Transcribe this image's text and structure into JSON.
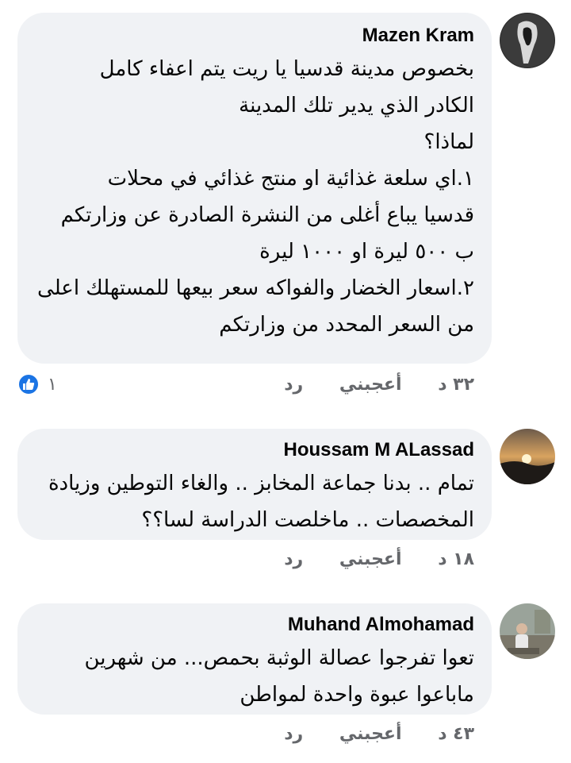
{
  "comments": [
    {
      "author": "Mazen Kram",
      "text": "بخصوص مدينة قدسيا يا ريت يتم اعفاء كامل\nالكادر الذي يدير تلك المدينة\nلماذا؟\n١.اي سلعة غذائية او منتج غذائي في محلات\nقدسيا يباع أغلى من النشرة الصادرة عن وزارتكم\nب ٥٠٠ ليرة او ١٠٠٠ ليرة\n٢.اسعار الخضار والفواكه سعر بيعها للمستهلك اعلى\nمن السعر المحدد من وزارتكم",
      "time": "٣٢ د",
      "like_label": "أعجبني",
      "reply_label": "رد",
      "reaction_count": "١",
      "avatar_icon": "user-avatar-dark"
    },
    {
      "author": "Houssam M ALassad",
      "text": "تمام .. بدنا جماعة المخابز .. والغاء التوطين وزيادة\nالمخصصات .. ماخلصت الدراسة لسا؟؟",
      "time": "١٨ د",
      "like_label": "أعجبني",
      "reply_label": "رد",
      "avatar_icon": "user-avatar-sunset"
    },
    {
      "author": "Muhand Almohamad",
      "text": "تعوا تفرجوا عصالة الوثبة بحمص... من شهرين\nماباعوا عبوة واحدة لمواطن",
      "time": "٤٣ د",
      "like_label": "أعجبني",
      "reply_label": "رد",
      "avatar_icon": "user-avatar-outdoor"
    }
  ],
  "colors": {
    "bubble": "#f0f2f5",
    "meta": "#65676b",
    "like": "#1b74e4"
  }
}
